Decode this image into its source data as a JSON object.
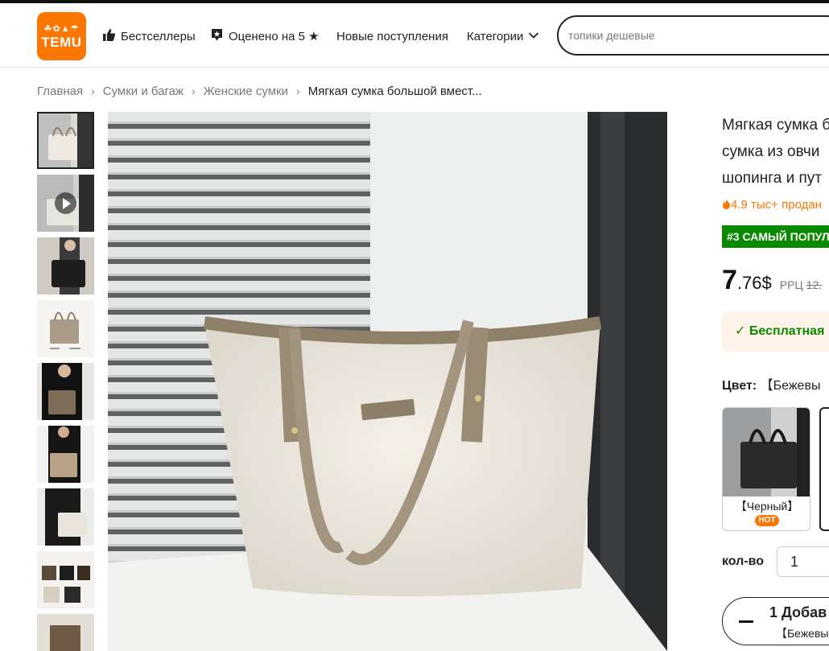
{
  "header": {
    "logo_text": "TEMU",
    "nav": [
      {
        "label": "Бестселлеры",
        "icon": "thumbs-up-icon"
      },
      {
        "label": "Оценено на 5 ★",
        "icon": "star-badge-icon"
      },
      {
        "label": "Новые поступления"
      },
      {
        "label": "Категории",
        "icon": "chevron-down-icon"
      }
    ],
    "search": {
      "placeholder": "топики дешевые"
    }
  },
  "breadcrumb": [
    "Главная",
    "Сумки и багаж",
    "Женские сумки",
    "Мягкая сумка большой вмест..."
  ],
  "product": {
    "title_lines": [
      "Мягкая сумка б",
      "сумка из овчи",
      "шопинга и пут"
    ],
    "sold": "4.9 тыс+ продан",
    "rank_badge": "#3 САМЫЙ ПОПУЛ",
    "price_int": "7",
    "price_frac": ".76$",
    "rrp_label": "РРЦ",
    "rrp_value": "12.",
    "shipping": "Бесплатная",
    "color_label": "Цвет:",
    "color_value": "【Бежевы",
    "swatches": [
      {
        "name": "【Черный】",
        "badge": "HOT"
      }
    ],
    "qty_label": "кол-во",
    "qty_value": "1",
    "cart_line1": "1 Добав",
    "cart_line2": "【Бежевы"
  },
  "colors": {
    "brand": "#fb7701",
    "rank_green": "#0a8800",
    "text": "#222222"
  }
}
